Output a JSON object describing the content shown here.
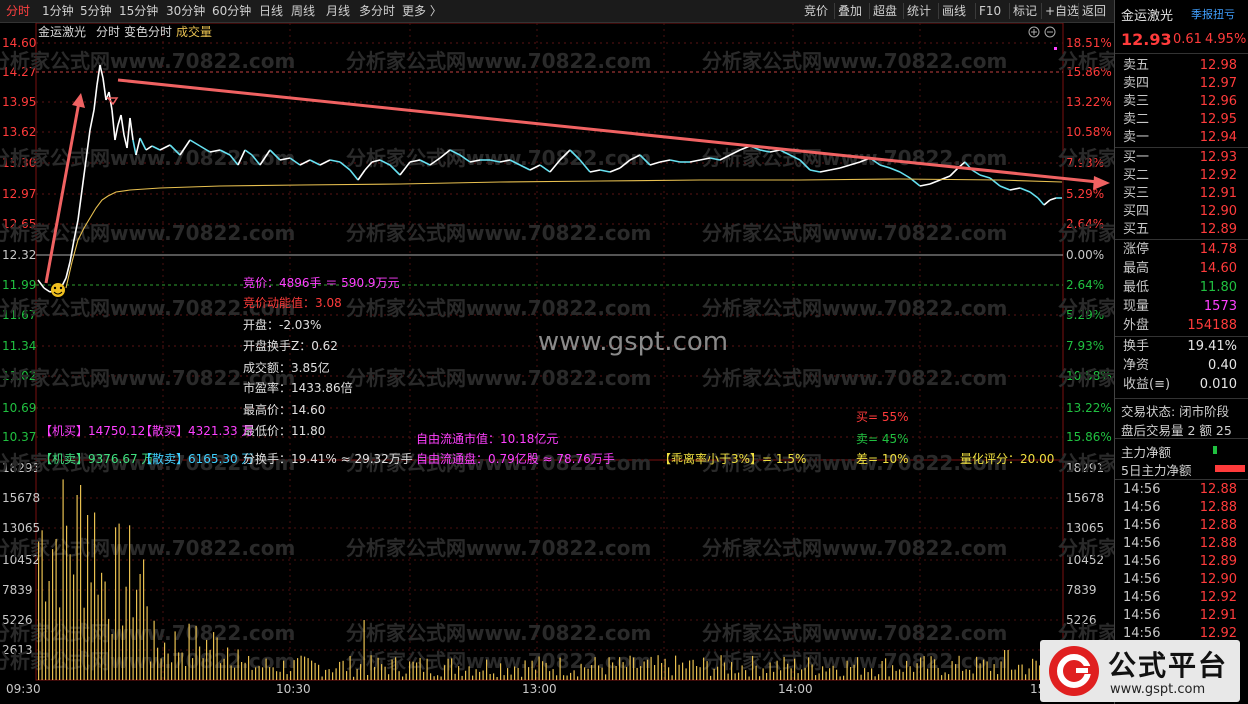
{
  "toolbar": {
    "periods": [
      "分时",
      "1分钟",
      "5分钟",
      "15分钟",
      "30分钟",
      "60分钟",
      "日线",
      "周线",
      "月线",
      "多分时",
      "更多 〉"
    ],
    "active_index": 0,
    "right": [
      "竞价",
      "叠加",
      "超盘",
      "统计",
      "画线",
      "F10",
      "标记",
      "+自选",
      "返回"
    ]
  },
  "chart": {
    "header": {
      "stock": "金运激光",
      "mode": "分时",
      "variant": "变色分时",
      "volume_label": "成交量"
    },
    "price_ticks": [
      "14.60",
      "14.27",
      "13.95",
      "13.62",
      "13.30",
      "12.97",
      "12.65",
      "12.32",
      "11.99",
      "11.67",
      "11.34",
      "11.02",
      "10.69",
      "10.37"
    ],
    "pct_ticks": [
      "18.51%",
      "15.86%",
      "13.22%",
      "10.58%",
      "7.93%",
      "5.29%",
      "2.64%",
      "0.00%",
      "2.64%",
      "5.29%",
      "7.93%",
      "10.58%",
      "13.22%",
      "15.86%"
    ],
    "vol_ticks": [
      "18291",
      "15678",
      "13065",
      "10452",
      "7839",
      "5226",
      "2613"
    ],
    "time_labels": [
      "09:30",
      "10:30",
      "13:00",
      "14:00",
      "15:00"
    ],
    "watermark_main": "www.gspt.com",
    "watermark_repeat": "分析家公式网www.70822.com",
    "colors": {
      "rise": "#ff3b3b",
      "fall": "#20c040",
      "line": "#66e0f0",
      "avg": "#e8c050",
      "trend": "#f06262"
    }
  },
  "overlay": {
    "auction": "竞价：4896手 ＝ 590.9万元",
    "auction_power": "竞价动能值：3.08",
    "open": "开盘：-2.03%",
    "open_turnover": "开盘换手Z：0.62",
    "amount": "成交额：3.85亿",
    "pe": "市盈率：1433.86倍",
    "high": "最高价：14.60",
    "low": "最低价：11.80",
    "inst_buy": "【机买】14750.12",
    "retail_buy": "【散买】4321.33 万",
    "inst_sell": "【机卖】9376.67 万",
    "retail_sell": "【散卖】6165.30 万",
    "turnover": "分换手：19.41% ≈ 29.32万手",
    "float_cap": "自由流通市值：10.18亿元",
    "float_shares": "自由流通盘：0.79亿股 ≈ 78.76万手",
    "deviation": "【乖离率小于3%】= 1.5%",
    "buy_pct": "买= 55%",
    "sell_pct": "卖= 45%",
    "diff": "差= 10%",
    "quant_score": "量化评分：20.00"
  },
  "side": {
    "name": "金运激光",
    "tag": "季报扭亏",
    "price": "12.93",
    "change": "0.61",
    "change_pct": "4.95%",
    "asks": [
      {
        "label": "卖五",
        "price": "12.98"
      },
      {
        "label": "卖四",
        "price": "12.97"
      },
      {
        "label": "卖三",
        "price": "12.96"
      },
      {
        "label": "卖二",
        "price": "12.95"
      },
      {
        "label": "卖一",
        "price": "12.94"
      }
    ],
    "bids": [
      {
        "label": "买一",
        "price": "12.93"
      },
      {
        "label": "买二",
        "price": "12.92"
      },
      {
        "label": "买三",
        "price": "12.91"
      },
      {
        "label": "买四",
        "price": "12.90"
      },
      {
        "label": "买五",
        "price": "12.89"
      }
    ],
    "stats": [
      {
        "label": "涨停",
        "value": "14.78",
        "color": "red"
      },
      {
        "label": "最高",
        "value": "14.60",
        "color": "red"
      },
      {
        "label": "最低",
        "value": "11.80",
        "color": "green"
      },
      {
        "label": "现量",
        "value": "1573",
        "color": "mag"
      },
      {
        "label": "外盘",
        "value": "154188",
        "color": "red"
      }
    ],
    "stats2": [
      {
        "label": "换手",
        "value": "19.41%",
        "color": "white"
      },
      {
        "label": "净资",
        "value": "0.40",
        "color": "white"
      },
      {
        "label": "收益(≡)",
        "value": "0.010",
        "color": "white"
      }
    ],
    "trade_status": "交易状态: 闭市阶段",
    "after_hours": "盘后交易量 2 额 25",
    "main_net": "主力净额",
    "main_net5": "5日主力净额",
    "ticks": [
      {
        "t": "14:56",
        "p": "12.88"
      },
      {
        "t": "14:56",
        "p": "12.88"
      },
      {
        "t": "14:56",
        "p": "12.88"
      },
      {
        "t": "14:56",
        "p": "12.88"
      },
      {
        "t": "14:56",
        "p": "12.89"
      },
      {
        "t": "14:56",
        "p": "12.90"
      },
      {
        "t": "14:56",
        "p": "12.92"
      },
      {
        "t": "14:56",
        "p": "12.91"
      },
      {
        "t": "14:56",
        "p": "12.92"
      }
    ]
  },
  "logo": {
    "text": "公式平台",
    "url": "www.gspt.com"
  }
}
